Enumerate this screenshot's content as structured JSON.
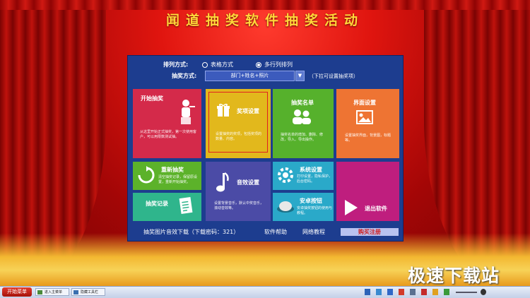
{
  "app": {
    "title": "闻道抽奖软件抽奖活动"
  },
  "settings": {
    "arrange_label": "排列方式:",
    "arrange_options": [
      "表格方式",
      "多行列排列"
    ],
    "arrange_selected": "多行列排列",
    "mode_label": "抽奖方式:",
    "mode_value": "部门+姓名+照片",
    "mode_hint": "（下拉可设置抽奖项）"
  },
  "tiles": {
    "start": {
      "title": "开始抽奖",
      "desc": "从这里开始正式抽奖，第一次使用客户，可以用限数测试抽。"
    },
    "prize": {
      "title": "奖项设置",
      "desc": "设置抽奖的奖项，包括奖项的数量、内容。"
    },
    "list": {
      "title": "抽奖名单",
      "desc": "抽奖名单的增加、删除、修改，导入、导出操作。"
    },
    "ui": {
      "title": "界面设置",
      "desc": "设置抽奖界面，背景图，标题等。"
    },
    "redo": {
      "title": "重新抽奖",
      "desc": "清空抽奖记录，保留原设置，重新开始抽奖。"
    },
    "sound": {
      "title": "音效设置",
      "desc": "设置背景音乐，默认中奖音乐，滚动音效等。"
    },
    "system": {
      "title": "系统设置",
      "desc": "打印设置，隐私保护，后台密码。"
    },
    "install": {
      "title": "安卓按钮",
      "desc": "安卓抽奖按钮的使用与教程。"
    },
    "exit": {
      "title": "退出软件"
    },
    "record": {
      "title": "抽奖记录"
    }
  },
  "footer": {
    "download": "抽奖图片音效下载（下载密码：321）",
    "help": "软件帮助",
    "tutorial": "网络教程",
    "buy": "购买注册"
  },
  "watermark": "极速下载站",
  "taskbar": {
    "start": "开始菜单",
    "tasks": [
      "进入主菜单",
      "隐藏工具栏"
    ]
  },
  "colors": {
    "start": "#d42a4a",
    "prize": "#e2b81c",
    "list": "#56b12c",
    "ui": "#ee7433",
    "redo": "#5cb22a",
    "sound": "#4b4ba6",
    "system": "#2aa9c9",
    "install": "#2aa9c9",
    "exit": "#bf1e7e",
    "record": "#2fb58c"
  }
}
